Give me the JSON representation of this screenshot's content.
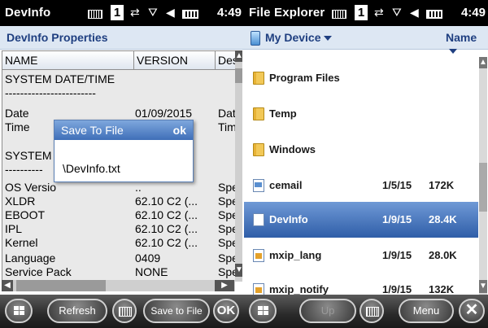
{
  "left": {
    "status": {
      "app": "DevInfo",
      "badge": "1",
      "time": "4:49"
    },
    "title": "DevInfo Properties",
    "columns": [
      "NAME",
      "VERSION",
      "Des"
    ],
    "rows": [
      {
        "name": "SYSTEM DATE/TIME",
        "version": "",
        "desc": ""
      },
      {
        "name": "------------------------",
        "version": "",
        "desc": ""
      },
      {
        "name": "Date",
        "version": "01/09/2015",
        "desc": "Dat"
      },
      {
        "name": "Time",
        "version": "",
        "desc": "Tim"
      },
      {
        "name": "",
        "version": "",
        "desc": ""
      },
      {
        "name": "SYSTEM I",
        "version": "",
        "desc": ""
      },
      {
        "name": "----------",
        "version": "",
        "desc": ""
      },
      {
        "name": "OS Versio",
        "version": "..",
        "desc": "Spe"
      },
      {
        "name": "XLDR",
        "version": "62.10 C2 (...",
        "desc": "Spe"
      },
      {
        "name": "EBOOT",
        "version": "62.10 C2 (...",
        "desc": "Spe"
      },
      {
        "name": "IPL",
        "version": "62.10 C2 (...",
        "desc": "Spe"
      },
      {
        "name": "Kernel",
        "version": "62.10 C2 (...",
        "desc": "Spe"
      },
      {
        "name": "Language",
        "version": "0409",
        "desc": "Spe"
      },
      {
        "name": "Service Pack",
        "version": "NONE",
        "desc": "Spe"
      }
    ],
    "dialog": {
      "title": "Save To File",
      "ok": "ok",
      "path": "\\DevInfo.txt"
    },
    "softkeys": {
      "refresh": "Refresh",
      "save": "Save to File",
      "ok": "OK"
    }
  },
  "right": {
    "status": {
      "app": "File Explorer",
      "badge": "1",
      "time": "4:49"
    },
    "location": "My Device",
    "sort": "Name",
    "files": [
      {
        "name": "Program Files",
        "date": "",
        "size": "",
        "icon": "folder-icon"
      },
      {
        "name": "Temp",
        "date": "",
        "size": "",
        "icon": "folder-icon"
      },
      {
        "name": "Windows",
        "date": "",
        "size": "",
        "icon": "folder-icon"
      },
      {
        "name": "cemail",
        "date": "1/5/15",
        "size": "172K",
        "icon": "mail-file-icon"
      },
      {
        "name": "DevInfo",
        "date": "1/9/15",
        "size": "28.4K",
        "icon": "document-icon"
      },
      {
        "name": "mxip_lang",
        "date": "1/9/15",
        "size": "28.0K",
        "icon": "xml-file-icon"
      },
      {
        "name": "mxip_notify",
        "date": "1/9/15",
        "size": "132K",
        "icon": "xml-file-icon"
      }
    ],
    "softkeys": {
      "up": "Up",
      "menu": "Menu"
    }
  }
}
